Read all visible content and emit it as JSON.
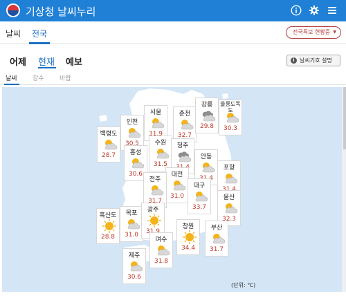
{
  "header": {
    "title": "기상청 날씨누리",
    "icons": [
      "info-icon",
      "gear-icon",
      "menu-icon"
    ]
  },
  "top_tabs": [
    {
      "label": "날씨",
      "active": false
    },
    {
      "label": "전국",
      "active": true
    }
  ],
  "region_select": {
    "value": "전국특보 현황중",
    "icon": "chevron-down-icon"
  },
  "view_tabs": [
    {
      "label": "어제",
      "active": false
    },
    {
      "label": "현재",
      "active": true
    },
    {
      "label": "예보",
      "active": false
    }
  ],
  "symbol_button": {
    "label": "날씨기호 설명",
    "icon": "info-icon"
  },
  "sub_tabs": [
    {
      "label": "날씨",
      "active": true
    },
    {
      "label": "강수",
      "active": false
    },
    {
      "label": "바람",
      "active": false
    }
  ],
  "map": {
    "unit_label": "(단위: ℃)",
    "land_color": "#ffffff",
    "sea_color": "#d4e5f6",
    "temp_color": "#c0392b",
    "stations": [
      {
        "name": "백령도",
        "temp": "28.7",
        "weather": "partly-cloudy"
      },
      {
        "name": "인천",
        "temp": "30.5",
        "weather": "partly-cloudy"
      },
      {
        "name": "서울",
        "temp": "31.9",
        "weather": "partly-cloudy"
      },
      {
        "name": "춘천",
        "temp": "32.7",
        "weather": "partly-cloudy"
      },
      {
        "name": "강릉",
        "temp": "29.8",
        "weather": "cloudy-dark"
      },
      {
        "name": "울릉도독도",
        "temp": "30.3",
        "weather": "partly-cloudy"
      },
      {
        "name": "수원",
        "temp": "31.5",
        "weather": "partly-cloudy"
      },
      {
        "name": "청주",
        "temp": "31.4",
        "weather": "cloudy-dark"
      },
      {
        "name": "홍성",
        "temp": "30.6",
        "weather": "partly-cloudy"
      },
      {
        "name": "안동",
        "temp": "31.4",
        "weather": "partly-cloudy"
      },
      {
        "name": "포항",
        "temp": "31.4",
        "weather": "partly-cloudy"
      },
      {
        "name": "대전",
        "temp": "31.0",
        "weather": "partly-cloudy"
      },
      {
        "name": "전주",
        "temp": "31.7",
        "weather": "partly-cloudy"
      },
      {
        "name": "대구",
        "temp": "33.7",
        "weather": "partly-cloudy"
      },
      {
        "name": "울산",
        "temp": "32.3",
        "weather": "partly-cloudy"
      },
      {
        "name": "흑산도",
        "temp": "28.8",
        "weather": "sunny"
      },
      {
        "name": "목포",
        "temp": "31.0",
        "weather": "partly-cloudy"
      },
      {
        "name": "광주",
        "temp": "31.9",
        "weather": "sunny"
      },
      {
        "name": "창원",
        "temp": "34.4",
        "weather": "sunny"
      },
      {
        "name": "부산",
        "temp": "31.7",
        "weather": "partly-cloudy"
      },
      {
        "name": "여수",
        "temp": "31.8",
        "weather": "partly-cloudy"
      },
      {
        "name": "제주",
        "temp": "30.6",
        "weather": "partly-cloudy"
      }
    ]
  }
}
